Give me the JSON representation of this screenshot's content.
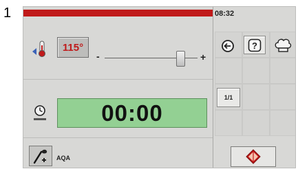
{
  "page_number": "1",
  "header": {
    "clock": "08:32",
    "progress_fraction": 1.0,
    "progress_color": "#c01a1a"
  },
  "temperature": {
    "value": "115°",
    "value_color": "#c01a1a",
    "minus_label": "-",
    "plus_label": "+",
    "slider_fraction": 0.82,
    "icon": "thermometer-icon"
  },
  "timer": {
    "value": "00:00",
    "icon": "timer-icon",
    "display_color": "#93d093"
  },
  "program": {
    "label": "AQA",
    "icon": "probe-add-icon"
  },
  "side_panel": {
    "back_icon": "back-arrow-icon",
    "help_label": "?",
    "help_icon": "help-icon",
    "chef_icon": "chef-hat-icon",
    "ratio_label": "1/1",
    "start_icon": "start-icon"
  }
}
